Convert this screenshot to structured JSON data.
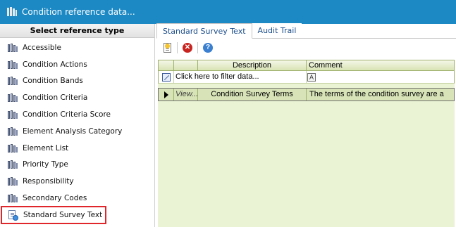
{
  "window": {
    "title": "Condition reference data..."
  },
  "left_panel": {
    "header": "Select reference type",
    "items": [
      {
        "label": "Accessible",
        "icon": "books-icon"
      },
      {
        "label": "Condition Actions",
        "icon": "books-icon"
      },
      {
        "label": "Condition Bands",
        "icon": "books-icon"
      },
      {
        "label": "Condition Criteria",
        "icon": "books-icon"
      },
      {
        "label": "Condition Criteria Score",
        "icon": "books-icon"
      },
      {
        "label": "Element Analysis Category",
        "icon": "books-icon"
      },
      {
        "label": "Element List",
        "icon": "books-icon"
      },
      {
        "label": "Priority Type",
        "icon": "books-icon"
      },
      {
        "label": "Responsibility",
        "icon": "books-icon"
      },
      {
        "label": "Secondary Codes",
        "icon": "books-icon"
      },
      {
        "label": "Standard Survey Text",
        "icon": "document-icon",
        "selected": true
      }
    ],
    "selection_color": "#e0262b"
  },
  "tabs": [
    {
      "label": "Standard Survey Text",
      "active": true
    },
    {
      "label": "Audit Trail",
      "active": false
    }
  ],
  "toolbar": {
    "buttons": [
      {
        "name": "new-icon"
      },
      {
        "name": "delete-icon"
      },
      {
        "name": "help-icon"
      }
    ]
  },
  "grid": {
    "columns": [
      "Description",
      "Comment"
    ],
    "filter_placeholder": "Click here to filter data...",
    "rows": [
      {
        "view": "View...",
        "description": "Condition Survey Terms",
        "comment": "The terms of the condition survey are a"
      }
    ]
  },
  "colors": {
    "titlebar": "#1c89c4",
    "grid_background": "#eaf3d3",
    "row_background": "#d8e4b8"
  }
}
